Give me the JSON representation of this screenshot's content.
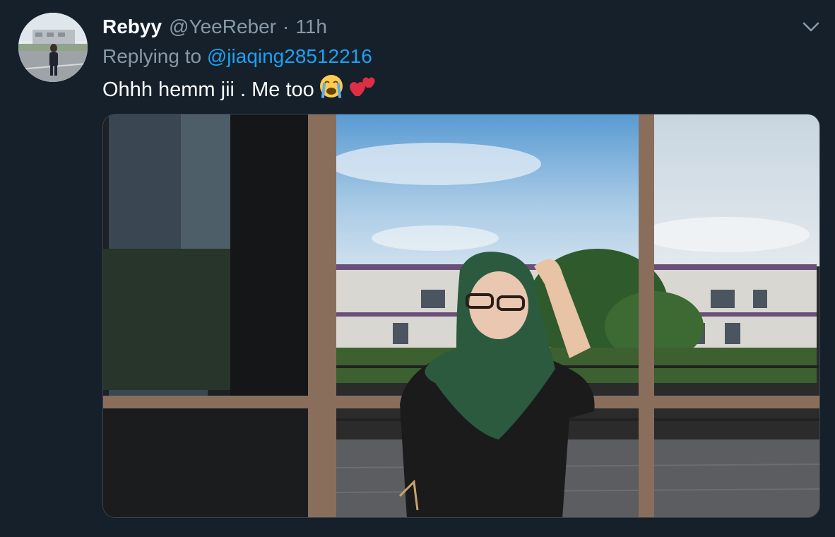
{
  "tweet": {
    "display_name": "Rebyy",
    "handle": "@YeeReber",
    "separator": "·",
    "time": "11h",
    "replying_prefix": "Replying to",
    "replying_to": "@jiaqing28512216",
    "text": "Ohhh hemm jii . Me too",
    "emojis": [
      "loudly-crying-face-icon",
      "two-hearts-icon"
    ],
    "media_description": "photo"
  },
  "icons": {
    "menu": "chevron-down-icon"
  },
  "colors": {
    "background": "#15202b",
    "secondary_text": "#8899a6",
    "link": "#1da1f2",
    "primary_text": "#ffffff"
  }
}
